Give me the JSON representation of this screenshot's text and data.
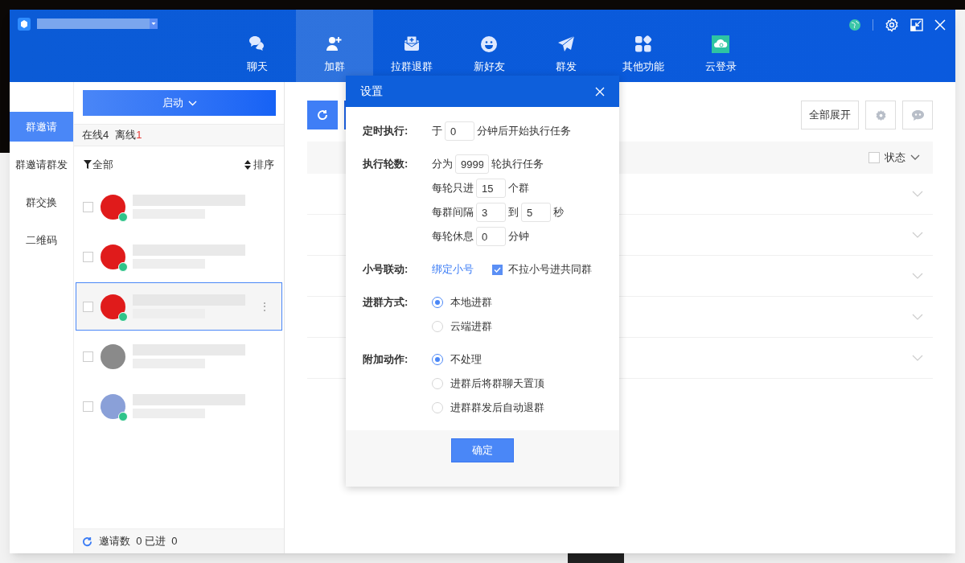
{
  "nav_tabs": [
    {
      "label": "聊天",
      "selected": false
    },
    {
      "label": "加群",
      "selected": true
    },
    {
      "label": "拉群退群",
      "selected": false
    },
    {
      "label": "新好友",
      "selected": false
    },
    {
      "label": "群发",
      "selected": false
    },
    {
      "label": "其他功能",
      "selected": false
    },
    {
      "label": "云登录",
      "selected": false
    }
  ],
  "side_menu": [
    {
      "label": "群邀请",
      "selected": true
    },
    {
      "label": "群邀请群发",
      "selected": false
    },
    {
      "label": "群交换",
      "selected": false
    },
    {
      "label": "二维码",
      "selected": false
    }
  ],
  "account_panel": {
    "start_button": "启动",
    "online_label": "在线",
    "online_count": "4",
    "offline_label": "离线",
    "offline_count": "1",
    "filter": "全部",
    "sort": "排序",
    "accounts": [
      {
        "kind": "red",
        "online": true,
        "checked": false,
        "selected": false
      },
      {
        "kind": "red",
        "online": true,
        "checked": false,
        "selected": false
      },
      {
        "kind": "red",
        "online": true,
        "checked": false,
        "selected": true,
        "more": "⋮"
      },
      {
        "kind": "grey",
        "online": false,
        "checked": false,
        "selected": false
      },
      {
        "kind": "cartoon",
        "online": true,
        "checked": false,
        "selected": false
      }
    ],
    "footer": "邀请数  0 已进  0"
  },
  "main": {
    "expand_all": "全部展开",
    "status_header": "状态",
    "status_checked": false,
    "row_count_rows": [
      {
        "expanded": false
      },
      {
        "expanded": false
      },
      {
        "expanded": false
      },
      {
        "expanded": false
      },
      {
        "expanded": false
      }
    ]
  },
  "dialog": {
    "title": "设置",
    "sections": [
      {
        "label": "定时执行:",
        "lines": [
          [
            {
              "kind": "text",
              "text": "于"
            },
            {
              "kind": "input",
              "value": "0"
            },
            {
              "kind": "text",
              "text": "分钟后开始执行任务"
            }
          ]
        ]
      },
      {
        "label": "执行轮数:",
        "lines": [
          [
            {
              "kind": "text",
              "text": "分为"
            },
            {
              "kind": "input",
              "value": "9999"
            },
            {
              "kind": "text",
              "text": "轮执行任务"
            }
          ],
          [
            {
              "kind": "text",
              "text": "每轮只进"
            },
            {
              "kind": "input",
              "value": "15"
            },
            {
              "kind": "text",
              "text": "个群"
            }
          ],
          [
            {
              "kind": "text",
              "text": "每群间隔"
            },
            {
              "kind": "input",
              "value": "3"
            },
            {
              "kind": "text",
              "text": "到"
            },
            {
              "kind": "input",
              "value": "5"
            },
            {
              "kind": "text",
              "text": "秒"
            }
          ],
          [
            {
              "kind": "text",
              "text": "每轮休息"
            },
            {
              "kind": "input",
              "value": "0"
            },
            {
              "kind": "text",
              "text": "分钟"
            }
          ]
        ]
      },
      {
        "label": "小号联动:",
        "lines": [
          [
            {
              "kind": "link",
              "text": "绑定小号"
            },
            {
              "kind": "checkbox",
              "text": "不拉小号进共同群",
              "checked": true
            }
          ]
        ]
      },
      {
        "label": "进群方式:",
        "lines": [
          [
            {
              "kind": "radio",
              "text": "本地进群",
              "selected": true
            }
          ],
          [
            {
              "kind": "radio",
              "text": "云端进群",
              "selected": false
            }
          ]
        ]
      },
      {
        "label": "附加动作:",
        "lines": [
          [
            {
              "kind": "radio",
              "text": "不处理",
              "selected": true
            }
          ],
          [
            {
              "kind": "radio",
              "text": "进群后将群聊天置顶",
              "selected": false
            }
          ],
          [
            {
              "kind": "radio",
              "text": "进群群发后自动退群",
              "selected": false
            }
          ]
        ]
      }
    ],
    "ok_button": "确定"
  }
}
